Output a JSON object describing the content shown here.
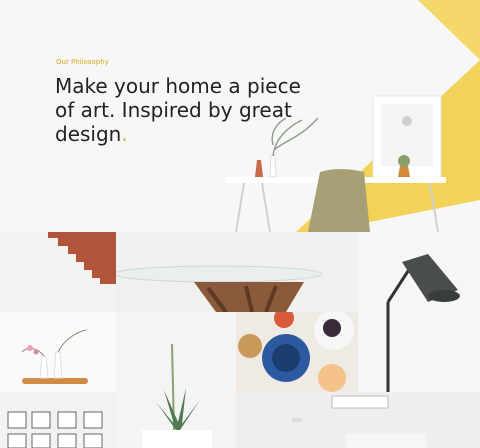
{
  "hero": {
    "eyebrow": "Our Philosophy",
    "headline": "Make your home a piece of art. Inspired by great design",
    "headline_end": ".",
    "accent_color": "#f3d25a"
  }
}
